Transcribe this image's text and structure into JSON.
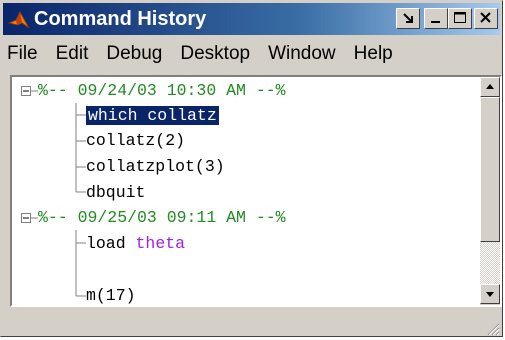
{
  "window": {
    "title": "Command History",
    "icon": "matlab-logo-icon",
    "controls": [
      "dock-icon",
      "minimize-icon",
      "maximize-icon",
      "close-icon"
    ]
  },
  "menu": [
    {
      "label": "File"
    },
    {
      "label": "Edit"
    },
    {
      "label": "Debug"
    },
    {
      "label": "Desktop"
    },
    {
      "label": "Window"
    },
    {
      "label": "Help"
    }
  ],
  "history": {
    "sessions": [
      {
        "header": "%-- 09/24/03 10:30 AM --%",
        "commands": [
          "which collatz",
          "collatz(2)",
          "collatzplot(3)",
          "dbquit"
        ]
      },
      {
        "header": "%-- 09/25/03 09:11 AM --%",
        "commands": [
          {
            "text": "load ",
            "keyword": "theta"
          },
          "m(17)"
        ]
      }
    ],
    "selected_command": "which collatz"
  },
  "colors": {
    "session_header": "#228b22",
    "keyword": "#a020f0",
    "selection": "#0a246a",
    "titlebar_start": "#0a246a",
    "titlebar_end": "#a6caf0"
  }
}
